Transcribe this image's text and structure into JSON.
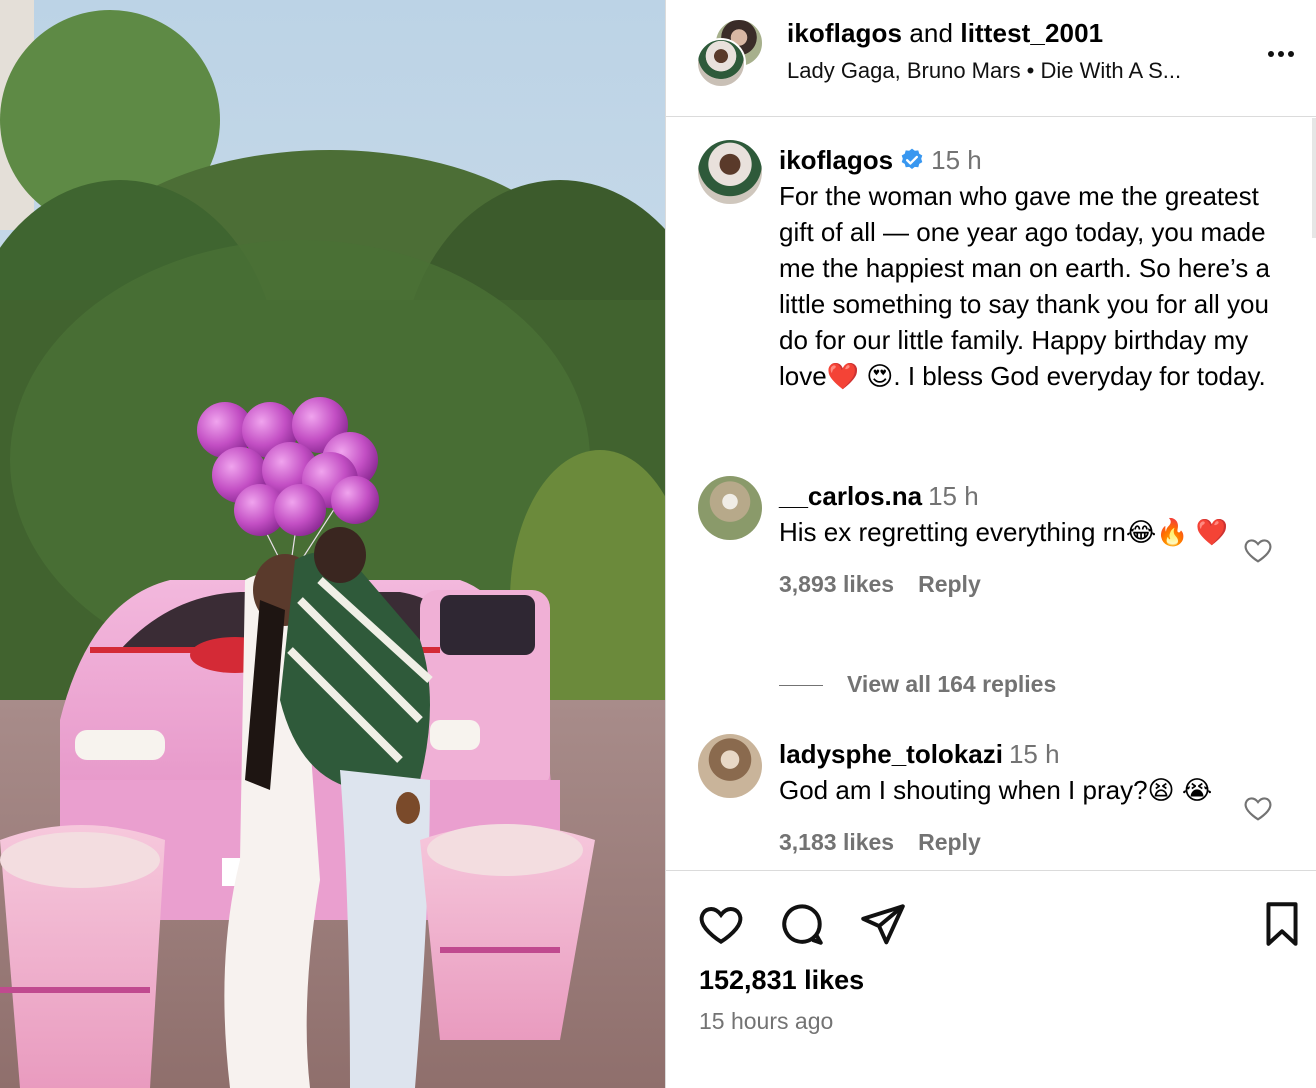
{
  "header": {
    "user1": "ikoflagos",
    "and": "and",
    "user2": "littest_2001",
    "audio": "Lady Gaga, Bruno Mars • Die With A S..."
  },
  "caption": {
    "username": "ikoflagos",
    "time": "15 h",
    "text": "For the woman who gave me the greatest gift of all — one year ago today, you made me the happiest man on earth. So here’s a little something to say thank you for all you do for our little family. Happy birthday my love❤️ 😍. I bless God everyday for today."
  },
  "comments": [
    {
      "username": "__carlos.na",
      "time": "15 h",
      "text": "His ex regretting everything rn😂🔥 ❤️",
      "likes": "3,893 likes",
      "reply": "Reply",
      "view_replies": "View all 164 replies"
    },
    {
      "username": "ladysphe_tolokazi",
      "time": "15 h",
      "text": "God am I shouting when I pray?😫 😭",
      "likes": "3,183 likes",
      "reply": "Reply"
    }
  ],
  "footer": {
    "likes": "152,831 likes",
    "time_ago": "15 hours ago"
  },
  "icons": {
    "like": "heart-icon",
    "comment": "comment-icon",
    "share": "share-icon",
    "save": "bookmark-icon",
    "more": "more-icon",
    "verified": "verified-icon"
  },
  "colors": {
    "verified": "#3897f0",
    "muted": "#737373",
    "divider": "#dbdbdb"
  }
}
